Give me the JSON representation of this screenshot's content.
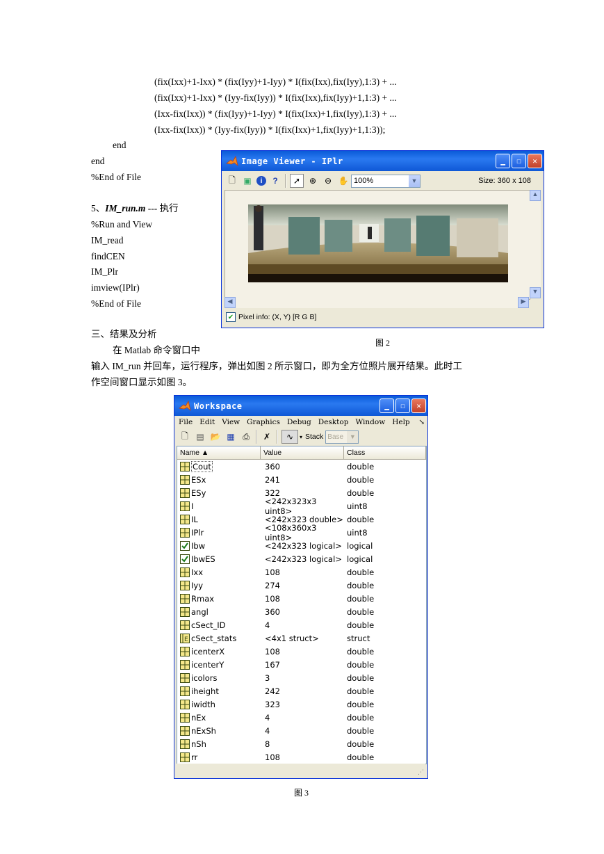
{
  "code_lines": [
    "(fix(Ixx)+1-Ixx) * (fix(Iyy)+1-Iyy) * I(fix(Ixx),fix(Iyy),1:3) + ...",
    "(fix(Ixx)+1-Ixx) * (Iyy-fix(Iyy)) * I(fix(Ixx),fix(Iyy)+1,1:3) + ...",
    "(Ixx-fix(Ixx)) * (fix(Iyy)+1-Iyy) * I(fix(Ixx)+1,fix(Iyy),1:3) + ...",
    "(Ixx-fix(Ixx)) * (Iyy-fix(Iyy)) * I(fix(Ixx)+1,fix(Iyy)+1,1:3));"
  ],
  "end_inner": "end",
  "end_outer": "end",
  "eof1": "%End of File",
  "section5": {
    "number": "5、",
    "name": "IM_run.m",
    "rest": " ---  执行"
  },
  "run_lines": [
    "%Run and View",
    "IM_read",
    "findCEN",
    "IM_Plr",
    "imview(IPlr)",
    "%End of File"
  ],
  "section3_heading": "三、结果及分析",
  "para_line1": "在 Matlab 命令窗口中",
  "para_line2": "输入 IM_run 并回车，运行程序，弹出如图 2 所示窗口，即为全方位照片展开结果。此时工",
  "para_line3": "作空间窗口显示如图 3。",
  "fig2_caption": "图 2",
  "fig3_caption": "图 3",
  "image_viewer": {
    "title": "Image Viewer - IPlr",
    "zoom": "100%",
    "size": "Size: 360 x 108",
    "pixel_info": "Pixel info: (X, Y)   [R G B]"
  },
  "workspace": {
    "title": "Workspace",
    "menu": [
      "File",
      "Edit",
      "View",
      "Graphics",
      "Debug",
      "Desktop",
      "Window",
      "Help"
    ],
    "stack_label": "Stack",
    "stack_value": "Base",
    "columns": [
      "Name ▲",
      "Value",
      "Class"
    ],
    "rows": [
      {
        "name": "Cout",
        "value": "360",
        "class": "double",
        "icon": "grid"
      },
      {
        "name": "ESx",
        "value": "241",
        "class": "double",
        "icon": "grid"
      },
      {
        "name": "ESy",
        "value": "322",
        "class": "double",
        "icon": "grid"
      },
      {
        "name": "I",
        "value": "<242x323x3 uint8>",
        "class": "uint8",
        "icon": "grid"
      },
      {
        "name": "IL",
        "value": "<242x323 double>",
        "class": "double",
        "icon": "grid"
      },
      {
        "name": "IPlr",
        "value": "<108x360x3 uint8>",
        "class": "uint8",
        "icon": "grid"
      },
      {
        "name": "Ibw",
        "value": "<242x323 logical>",
        "class": "logical",
        "icon": "check"
      },
      {
        "name": "IbwES",
        "value": "<242x323 logical>",
        "class": "logical",
        "icon": "check"
      },
      {
        "name": "Ixx",
        "value": "108",
        "class": "double",
        "icon": "grid"
      },
      {
        "name": "Iyy",
        "value": "274",
        "class": "double",
        "icon": "grid"
      },
      {
        "name": "Rmax",
        "value": "108",
        "class": "double",
        "icon": "grid"
      },
      {
        "name": "angl",
        "value": "360",
        "class": "double",
        "icon": "grid"
      },
      {
        "name": "cSect_ID",
        "value": "4",
        "class": "double",
        "icon": "grid"
      },
      {
        "name": "cSect_stats",
        "value": "<4x1 struct>",
        "class": "struct",
        "icon": "struct"
      },
      {
        "name": "icenterX",
        "value": "108",
        "class": "double",
        "icon": "grid"
      },
      {
        "name": "icenterY",
        "value": "167",
        "class": "double",
        "icon": "grid"
      },
      {
        "name": "icolors",
        "value": "3",
        "class": "double",
        "icon": "grid"
      },
      {
        "name": "iheight",
        "value": "242",
        "class": "double",
        "icon": "grid"
      },
      {
        "name": "iwidth",
        "value": "323",
        "class": "double",
        "icon": "grid"
      },
      {
        "name": "nEx",
        "value": "4",
        "class": "double",
        "icon": "grid"
      },
      {
        "name": "nExSh",
        "value": "4",
        "class": "double",
        "icon": "grid"
      },
      {
        "name": "nSh",
        "value": "8",
        "class": "double",
        "icon": "grid"
      },
      {
        "name": "rr",
        "value": "108",
        "class": "double",
        "icon": "grid"
      }
    ]
  }
}
